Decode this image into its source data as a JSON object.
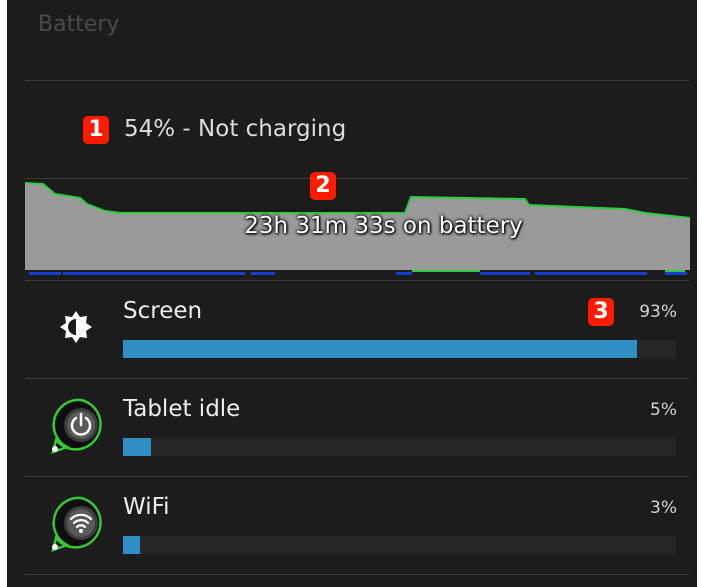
{
  "header": {
    "title": "Battery"
  },
  "status": {
    "text": "54% - Not charging"
  },
  "history": {
    "text": "23h 31m 33s on battery"
  },
  "badges": [
    "1",
    "2",
    "3"
  ],
  "usage": [
    {
      "label": "Screen",
      "percent_label": "93%",
      "percent": 93,
      "icon": "brightness-icon"
    },
    {
      "label": "Tablet idle",
      "percent_label": "5%",
      "percent": 5,
      "icon": "power-icon"
    },
    {
      "label": "WiFi",
      "percent_label": "3%",
      "percent": 3,
      "icon": "wifi-icon"
    }
  ],
  "colors": {
    "graph_fill": "#9a9a9a",
    "graph_line": "#2ecc40",
    "bar_fill": "#2f8fc4",
    "badge": "#ff1a00"
  }
}
